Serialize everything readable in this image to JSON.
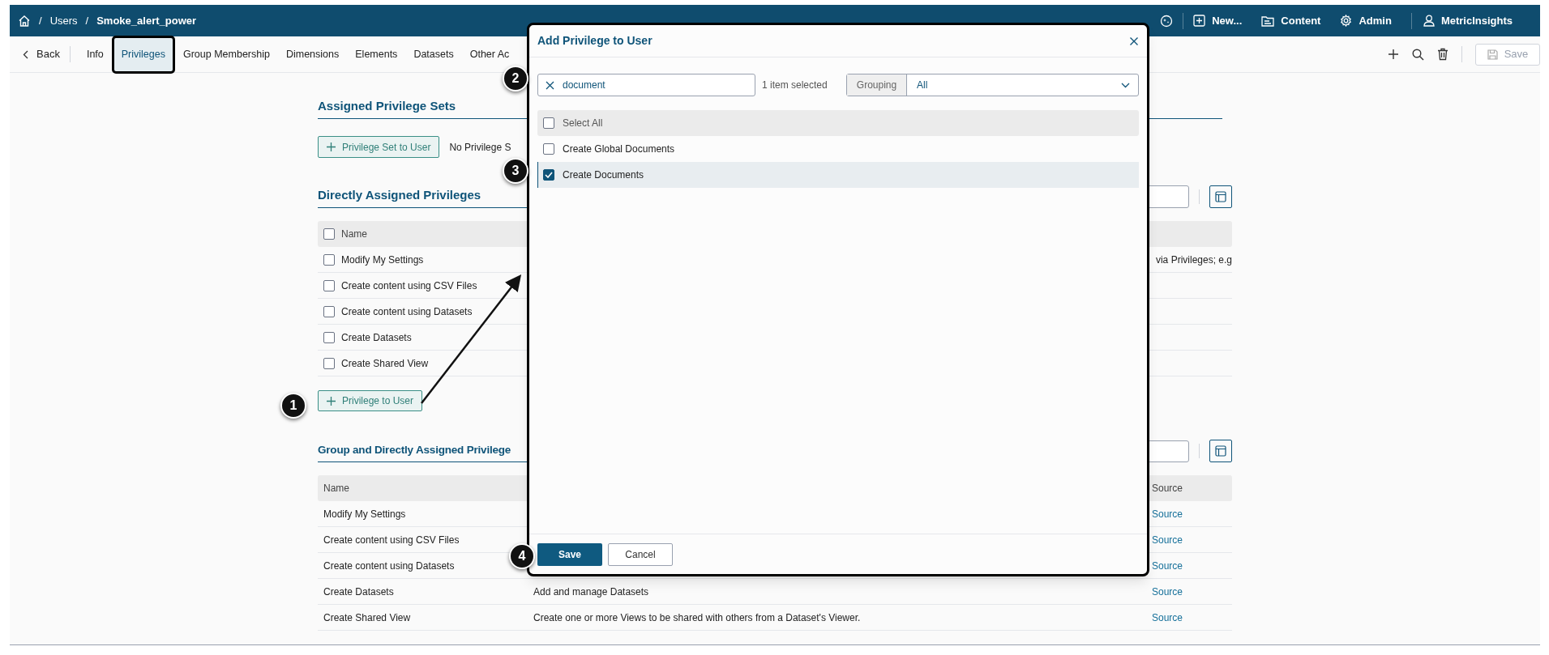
{
  "breadcrumb": [
    {
      "separator": "/",
      "label": "Users"
    },
    {
      "separator": "/",
      "label": "Smoke_alert_power"
    }
  ],
  "top_menu": [
    {
      "kind": "new",
      "label": "New..."
    },
    {
      "kind": "content",
      "label": "Content"
    },
    {
      "kind": "admin",
      "label": "Admin"
    },
    {
      "kind": "user",
      "label": "MetricInsights"
    }
  ],
  "toolbar": {
    "back": "Back",
    "tabs": [
      {
        "label": "Info",
        "selected": false
      },
      {
        "label": "Privileges",
        "selected": true
      },
      {
        "label": "Group Membership",
        "selected": false
      },
      {
        "label": "Dimensions",
        "selected": false
      },
      {
        "label": "Elements",
        "selected": false
      },
      {
        "label": "Datasets",
        "selected": false
      },
      {
        "label": "Other Ac",
        "selected": false
      }
    ],
    "save": {
      "label": "Save",
      "disabled": true
    }
  },
  "privilege_sets": {
    "title": "Assigned Privilege Sets",
    "add_button": "Privilege Set to User",
    "empty_text": "No Privilege S"
  },
  "direct_privileges": {
    "title": "Directly Assigned Privileges",
    "all_checked": false,
    "columns": [
      "Name"
    ],
    "rows": [
      {
        "name": "Modify My Settings",
        "checked": false,
        "description": "via Privileges; e.g"
      },
      {
        "name": "Create content using CSV Files",
        "checked": false
      },
      {
        "name": "Create content using Datasets",
        "checked": false
      },
      {
        "name": "Create Datasets",
        "checked": false
      },
      {
        "name": "Create Shared View",
        "checked": false
      }
    ],
    "add_button": "Privilege to User"
  },
  "group_privileges": {
    "title": "Group and Directly Assigned Privilege",
    "columns": [
      "Name",
      "Source"
    ],
    "rows": [
      {
        "name": "Modify My Settings",
        "source": "Source"
      },
      {
        "name": "Create content using CSV Files",
        "source": "Source"
      },
      {
        "name": "Create content using Datasets",
        "source": "Source"
      },
      {
        "name": "Create Datasets",
        "description": "Add and manage Datasets",
        "source": "Source"
      },
      {
        "name": "Create Shared View",
        "description": "Create one or more Views to be shared with others from a Dataset's Viewer.",
        "source": "Source"
      }
    ]
  },
  "dialog": {
    "title": "Add Privilege to User",
    "search": {
      "value": "document"
    },
    "selection_text": "1 item selected",
    "grouping": {
      "label": "Grouping",
      "value": "All"
    },
    "select_all": {
      "label": "Select All",
      "checked": false
    },
    "items": [
      {
        "label": "Create Global Documents",
        "checked": false
      },
      {
        "label": "Create Documents",
        "checked": true
      }
    ],
    "buttons": [
      {
        "kind": "primary",
        "label": "Save"
      },
      {
        "kind": "secondary",
        "label": "Cancel"
      }
    ]
  },
  "callouts": [
    {
      "number": "1"
    },
    {
      "number": "2"
    },
    {
      "number": "3"
    },
    {
      "number": "4"
    }
  ]
}
